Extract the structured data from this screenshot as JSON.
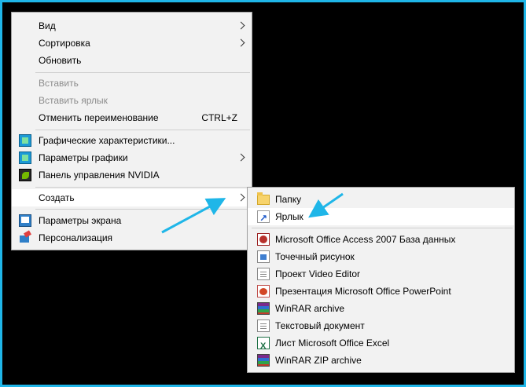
{
  "context_menu": {
    "items": [
      {
        "label": "Вид",
        "submenu": true
      },
      {
        "label": "Сортировка",
        "submenu": true
      },
      {
        "label": "Обновить"
      },
      {
        "label": "Вставить",
        "disabled": true
      },
      {
        "label": "Вставить ярлык",
        "disabled": true
      },
      {
        "label": "Отменить переименование",
        "shortcut": "CTRL+Z"
      },
      {
        "label": "Графические характеристики...",
        "icon": "intel-graphics-icon"
      },
      {
        "label": "Параметры графики",
        "icon": "intel-graphics-options-icon",
        "submenu": true
      },
      {
        "label": "Панель управления NVIDIA",
        "icon": "nvidia-icon"
      },
      {
        "label": "Создать",
        "submenu": true,
        "highlighted": true
      },
      {
        "label": "Параметры экрана",
        "icon": "display-settings-icon"
      },
      {
        "label": "Персонализация",
        "icon": "personalization-icon"
      }
    ]
  },
  "create_submenu": {
    "items": [
      {
        "label": "Папку",
        "icon": "folder-icon"
      },
      {
        "label": "Ярлык",
        "icon": "shortcut-icon",
        "highlighted": true
      },
      {
        "label": "Microsoft Office Access 2007 База данных",
        "icon": "access-icon"
      },
      {
        "label": "Точечный рисунок",
        "icon": "bitmap-icon"
      },
      {
        "label": "Проект Video Editor",
        "icon": "document-icon"
      },
      {
        "label": "Презентация Microsoft Office PowerPoint",
        "icon": "powerpoint-icon"
      },
      {
        "label": "WinRAR archive",
        "icon": "winrar-icon"
      },
      {
        "label": "Текстовый документ",
        "icon": "text-document-icon"
      },
      {
        "label": "Лист Microsoft Office Excel",
        "icon": "excel-icon"
      },
      {
        "label": "WinRAR ZIP archive",
        "icon": "winrar-zip-icon"
      }
    ]
  },
  "colors": {
    "frame": "#1fb6e8",
    "annotation_arrow": "#1fb6e8",
    "menu_bg": "#f2f2f2",
    "highlight": "#ffffff"
  }
}
